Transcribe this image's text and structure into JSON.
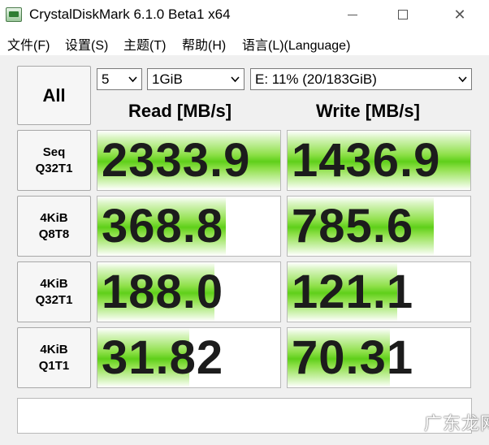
{
  "window": {
    "title": "CrystalDiskMark 6.1.0 Beta1 x64",
    "minimize_glyph": "",
    "close_glyph": "✕"
  },
  "menu": {
    "items": [
      "文件(F)",
      "设置(S)",
      "主题(T)",
      "帮助(H)",
      "语言(L)(Language)"
    ]
  },
  "controls": {
    "all_label": "All",
    "test_count": "5",
    "test_size": "1GiB",
    "drive": "E: 11% (20/183GiB)"
  },
  "headers": {
    "read": "Read [MB/s]",
    "write": "Write [MB/s]"
  },
  "tests": [
    {
      "line1": "Seq",
      "line2": "Q32T1",
      "read": "2333.9",
      "write": "1436.9",
      "read_fill": 1.0,
      "write_fill": 1.0
    },
    {
      "line1": "4KiB",
      "line2": "Q8T8",
      "read": "368.8",
      "write": "785.6",
      "read_fill": 0.7,
      "write_fill": 0.8
    },
    {
      "line1": "4KiB",
      "line2": "Q32T1",
      "read": "188.0",
      "write": "121.1",
      "read_fill": 0.64,
      "write_fill": 0.6
    },
    {
      "line1": "4KiB",
      "line2": "Q1T1",
      "read": "31.82",
      "write": "70.31",
      "read_fill": 0.5,
      "write_fill": 0.56
    }
  ],
  "status": "",
  "watermark": "广东龙网",
  "colors": {
    "bar_green": "#5fcf1a",
    "value_text": "#1c1c1c"
  }
}
